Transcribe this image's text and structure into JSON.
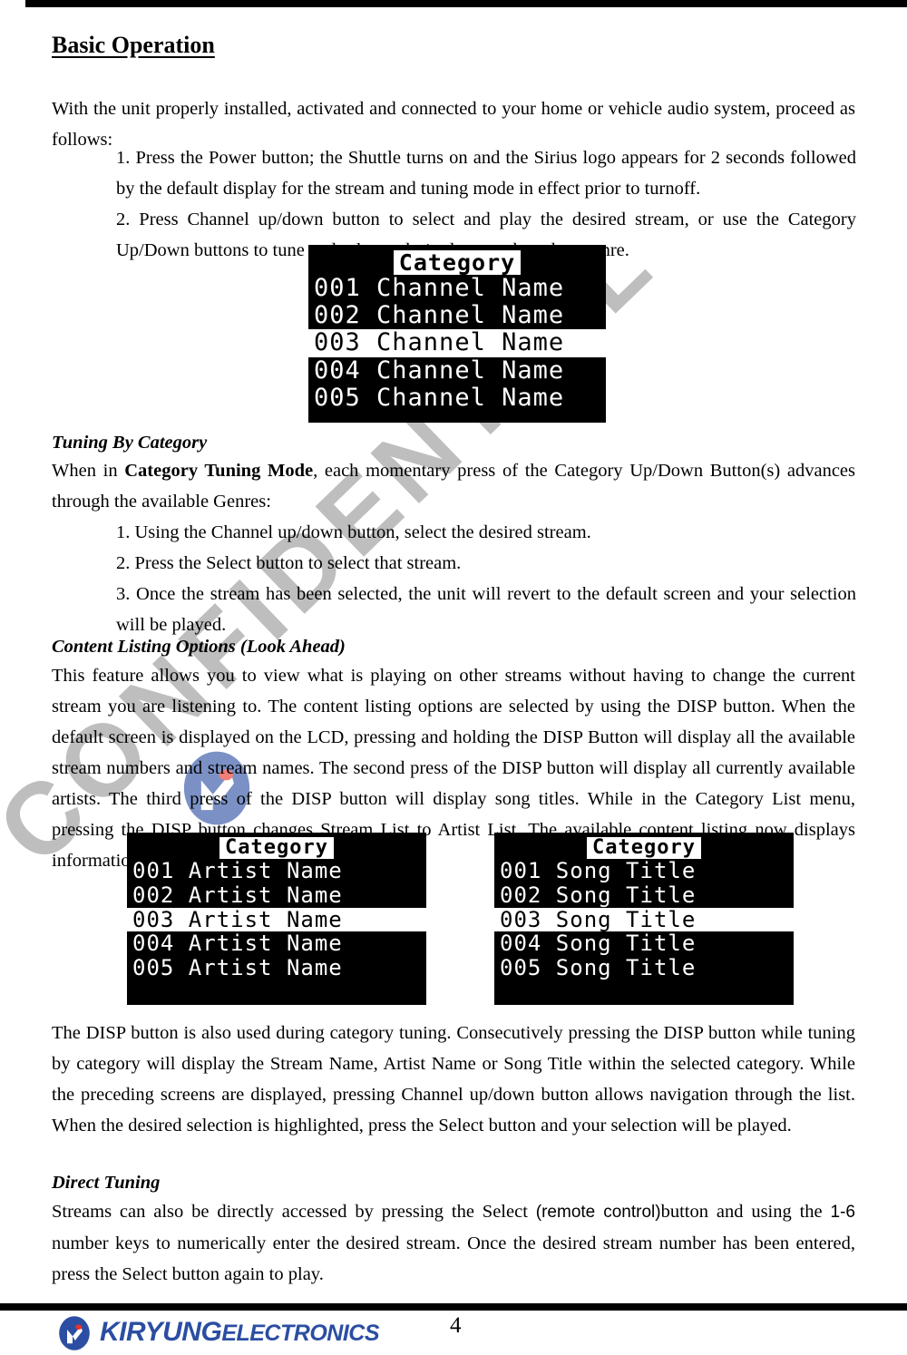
{
  "document": {
    "section_heading": "Basic Operation",
    "page_number": "4",
    "watermark": "CONFIDENTIAL"
  },
  "intro": {
    "paragraph": "With the unit properly installed, activated and connected to your home or vehicle audio system, proceed as follows:",
    "steps": [
      "1. Press the Power button; the Shuttle turns on and the Sirius logo appears for 2 seconds followed by the default display for the stream and tuning mode in effect prior to turnoff.",
      "2. Press Channel up/down button to select and play the desired stream, or use the Category Up/Down buttons to tune and select a desired stream based on genre."
    ]
  },
  "lcd_screens": {
    "channel_list": {
      "title": "Category",
      "rows": [
        {
          "number": "001",
          "text": "Channel Name",
          "highlighted": false
        },
        {
          "number": "002",
          "text": "Channel Name",
          "highlighted": false
        },
        {
          "number": "003",
          "text": "Channel Name",
          "highlighted": true
        },
        {
          "number": "004",
          "text": "Channel Name",
          "highlighted": false
        },
        {
          "number": "005",
          "text": "Channel Name",
          "highlighted": false
        }
      ]
    },
    "artist_list": {
      "title": "Category",
      "rows": [
        {
          "number": "001",
          "text": "Artist Name",
          "highlighted": false
        },
        {
          "number": "002",
          "text": "Artist Name",
          "highlighted": false
        },
        {
          "number": "003",
          "text": "Artist Name",
          "highlighted": true
        },
        {
          "number": "004",
          "text": "Artist Name",
          "highlighted": false
        },
        {
          "number": "005",
          "text": "Artist Name",
          "highlighted": false
        }
      ]
    },
    "song_list": {
      "title": "Category",
      "rows": [
        {
          "number": "001",
          "text": "Song Title",
          "highlighted": false
        },
        {
          "number": "002",
          "text": "Song Title",
          "highlighted": false
        },
        {
          "number": "003",
          "text": "Song Title",
          "highlighted": true
        },
        {
          "number": "004",
          "text": "Song Title",
          "highlighted": false
        },
        {
          "number": "005",
          "text": "Song Title",
          "highlighted": false
        }
      ]
    }
  },
  "tuning_by_category": {
    "heading": "Tuning By Category",
    "intro_pre": "When in ",
    "intro_bold": "Category Tuning Mode",
    "intro_post": ", each momentary press of the Category Up/Down Button(s) advances through the available Genres:",
    "steps": [
      "1. Using the Channel up/down button, select the desired stream.",
      "2. Press the Select button to select that stream.",
      "3. Once the stream has been selected, the unit will revert to the default screen and your selection will be played."
    ]
  },
  "content_listing": {
    "heading": "Content Listing Options (Look Ahead)",
    "body": "This feature allows you to view what is playing on other streams without having to change the current stream you are listening to. The content listing options are selected by using the DISP button. When the default screen is displayed on the LCD, pressing and holding the DISP Button will display all the available stream numbers and stream names. The second press of the DISP button will display all currently available artists. The third press of the DISP button will display song titles. While in the Category List menu, pressing the DISP button changes Stream List to Artist List. The available content listing now displays information by the Artist Name."
  },
  "disp_note": {
    "body": "The DISP button is also used during category tuning. Consecutively pressing the DISP button while tuning by category will display the Stream Name, Artist Name or Song Title within the selected category. While the preceding screens are displayed, pressing Channel up/down button allows navigation through the list. When the desired selection is highlighted, press the Select button and your selection will be played."
  },
  "direct_tuning": {
    "heading": "Direct Tuning",
    "body_1": "Streams can also be directly accessed by pressing the Select ",
    "body_sans_1": "(remote control)",
    "body_2": "button and using the ",
    "body_sans_2": "1-6",
    "body_3": " number keys to numerically enter the desired stream. Once the desired stream number has been entered, press the Select button again to play."
  },
  "footer": {
    "brand_primary": "KIRYUNG",
    "brand_secondary": "ELECTRONICS",
    "brand_color": "#2b4ea2",
    "accent_color": "#e8312a"
  }
}
